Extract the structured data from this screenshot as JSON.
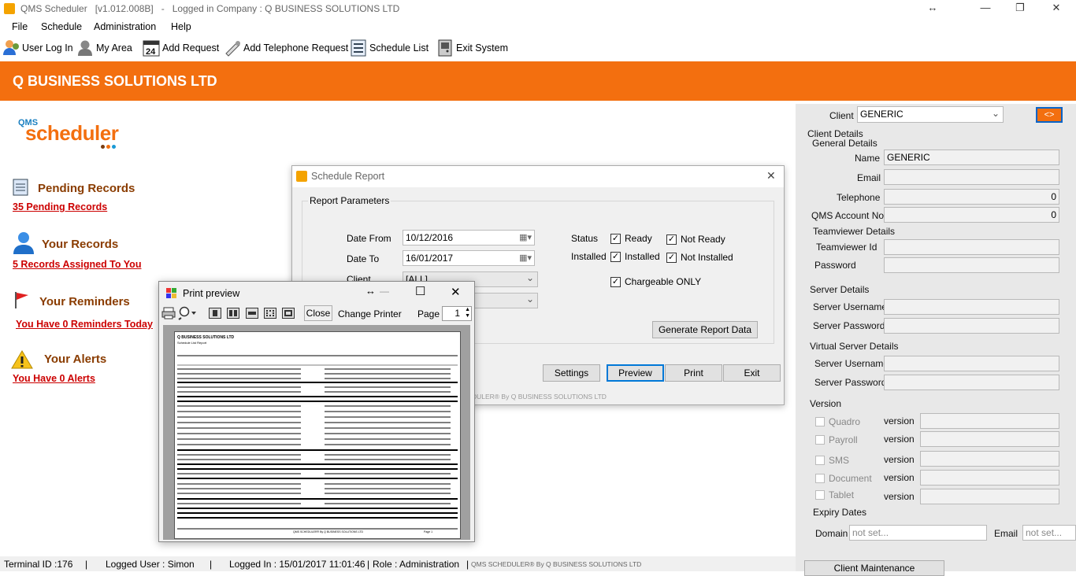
{
  "window": {
    "title": "QMS Scheduler   [v1.012.008B]   -   Logged in Company : Q BUSINESS SOLUTIONS LTD",
    "resize_glyph": "↔",
    "minimize": "—",
    "restore": "❐",
    "close": "✕"
  },
  "menu": [
    "File",
    "Schedule",
    "Administration",
    "Help"
  ],
  "toolbar": {
    "user_log_in": "User Log In",
    "my_area": "My Area",
    "add_request": "Add Request",
    "add_request_icon_number": "24",
    "add_telephone_request": "Add Telephone Request",
    "schedule_list": "Schedule List",
    "exit_system": "Exit System"
  },
  "banner": {
    "company": "Q BUSINESS SOLUTIONS LTD",
    "color": "#f36f0f"
  },
  "logo": {
    "small": "QMS",
    "big": "scheduler"
  },
  "left_panel": {
    "pending": {
      "heading": "Pending Records",
      "link": "35 Pending Records"
    },
    "records": {
      "heading": "Your Records",
      "link": "5 Records Assigned To You"
    },
    "reminders": {
      "heading": "Your Reminders",
      "link": "You Have 0 Reminders Today"
    },
    "alerts": {
      "heading": "Your Alerts",
      "link": "You Have 0 Alerts"
    }
  },
  "right_panel": {
    "client_label": "Client",
    "client_value": "GENERIC",
    "toggle_button": "<>",
    "client_details": "Client Details",
    "general_details": "General Details",
    "name_label": "Name",
    "name_value": "GENERIC",
    "email_label": "Email",
    "telephone_label": "Telephone",
    "telephone_value": "0",
    "qms_account_label": "QMS Account No",
    "qms_account_value": "0",
    "teamviewer_details": "Teamviewer Details",
    "teamviewer_id_label": "Teamviewer Id",
    "password_label": "Password",
    "server_details": "Server Details",
    "server_username_label": "Server Username",
    "server_password_label": "Server Password",
    "virtual_server_details": "Virtual Server Details",
    "vserver_username_label": "Server Username",
    "vserver_password_label": "Server Password",
    "version_heading": "Version",
    "version_label": "version",
    "modules": [
      "Quadro",
      "Payroll",
      "SMS",
      "Document",
      "Tablet"
    ],
    "expiry_dates": "Expiry Dates",
    "domain_label": "Domain",
    "domain_placeholder": "not set...",
    "email_expiry_label": "Email",
    "email_expiry_placeholder": "not set...",
    "client_maintenance": "Client Maintenance"
  },
  "schedule_report": {
    "title": "Schedule Report",
    "close": "✕",
    "group_label": "Report Parameters",
    "date_from_label": "Date From",
    "date_from_value": "10/12/2016",
    "date_to_label": "Date To",
    "date_to_value": "16/01/2017",
    "client_label": "Client",
    "client_value": "[ALL]",
    "status_label": "Status",
    "installed_label": "Installed",
    "ready": "Ready",
    "not_ready": "Not Ready",
    "installed": "Installed",
    "not_installed": "Not Installed",
    "chargeable_only": "Chargeable ONLY",
    "check_mark": "✓",
    "generate_button": "Generate Report Data",
    "settings_button": "Settings",
    "preview_button": "Preview",
    "print_button": "Print",
    "exit_button": "Exit",
    "footer": "DULER® By Q BUSINESS SOLUTIONS LTD"
  },
  "print_preview": {
    "title": "Print preview",
    "resize_glyph": "↔",
    "minimize": "—",
    "maximize": "☐",
    "close": "✕",
    "close_button": "Close",
    "change_printer": "Change Printer",
    "page_label": "Page",
    "page_value": "1",
    "report_company": "Q BUSINESS SOLUTIONS LTD",
    "report_name": "Schedule List Report",
    "report_footer": "QMS SCHEDULER® By Q BUSINESS SOLUTIONS LTD",
    "report_page": "Page 1"
  },
  "status_bar": {
    "terminal": "Terminal ID :176",
    "user": "Logged User : Simon",
    "logged_in": "Logged In : 15/01/2017 11:01:46",
    "role": "Role : Administration",
    "brand": "QMS SCHEDULER® By Q BUSINESS SOLUTIONS LTD",
    "separator": "|"
  }
}
